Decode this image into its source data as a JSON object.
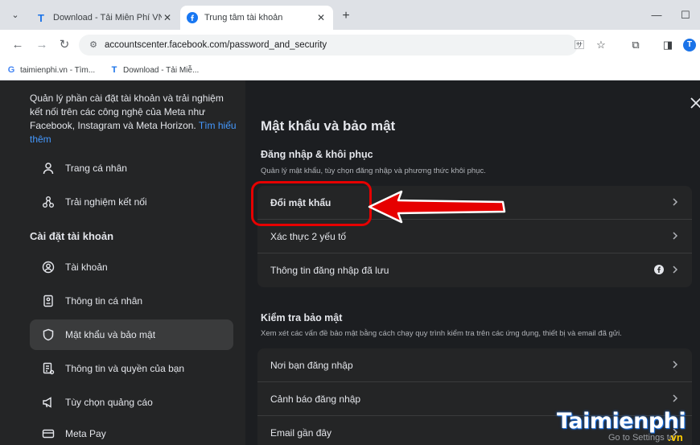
{
  "browser": {
    "tabs": [
      {
        "title": "Download - Tải Miễn Phí VN - P",
        "favicon": "T",
        "active": false
      },
      {
        "title": "Trung tâm tài khoản",
        "favicon": "f",
        "active": true
      }
    ],
    "url": "accountscenter.facebook.com/password_and_security",
    "profile_initial": "T",
    "bookmarks": [
      "taimienphi.vn - Tìm...",
      "Download - Tải Miễ..."
    ],
    "colors": {
      "chrome_bg": "#dee1e6",
      "accent": "#1a73e8"
    }
  },
  "sidebar": {
    "intro_text": "Quản lý phần cài đặt tài khoản và trải nghiệm kết nối trên các công nghệ của Meta như Facebook, Instagram và Meta Horizon.",
    "intro_link": "Tìm hiểu thêm",
    "top_items": [
      {
        "label": "Trang cá nhân",
        "icon": "person-icon"
      },
      {
        "label": "Trải nghiệm kết nối",
        "icon": "connected-icon"
      }
    ],
    "section_heading": "Cài đặt tài khoản",
    "account_items": [
      {
        "label": "Tài khoản",
        "icon": "account-circle-icon"
      },
      {
        "label": "Thông tin cá nhân",
        "icon": "id-card-icon"
      },
      {
        "label": "Mật khẩu và bảo mật",
        "icon": "shield-icon",
        "active": true
      },
      {
        "label": "Thông tin và quyền của bạn",
        "icon": "document-icon"
      },
      {
        "label": "Tùy chọn quảng cáo",
        "icon": "megaphone-icon"
      },
      {
        "label": "Meta Pay",
        "icon": "card-icon"
      }
    ]
  },
  "main": {
    "title": "Mật khẩu và bảo mật",
    "login_section": {
      "title": "Đăng nhập & khôi phục",
      "desc": "Quản lý mật khẩu, tùy chọn đăng nhập và phương thức khôi phục.",
      "rows": [
        "Đổi mật khẩu",
        "Xác thực 2 yếu tố",
        "Thông tin đăng nhập đã lưu"
      ]
    },
    "check_section": {
      "title": "Kiểm tra bảo mật",
      "desc": "Xem xét các vấn đề bảo mật bằng cách chạy quy trình kiểm tra trên các ứng dụng, thiết bị và email đã gửi.",
      "rows": [
        "Nơi bạn đăng nhập",
        "Cảnh báo đăng nhập",
        "Email gần đây"
      ]
    }
  },
  "watermark": {
    "text": "Taimienphi",
    "vn": ".vn",
    "sub": "Go to Settings to"
  },
  "colors": {
    "page_bg": "#1c1e21",
    "panel_bg": "#242526",
    "text": "#e4e6eb",
    "muted": "#b0b3b8",
    "highlight": "#e60000"
  }
}
